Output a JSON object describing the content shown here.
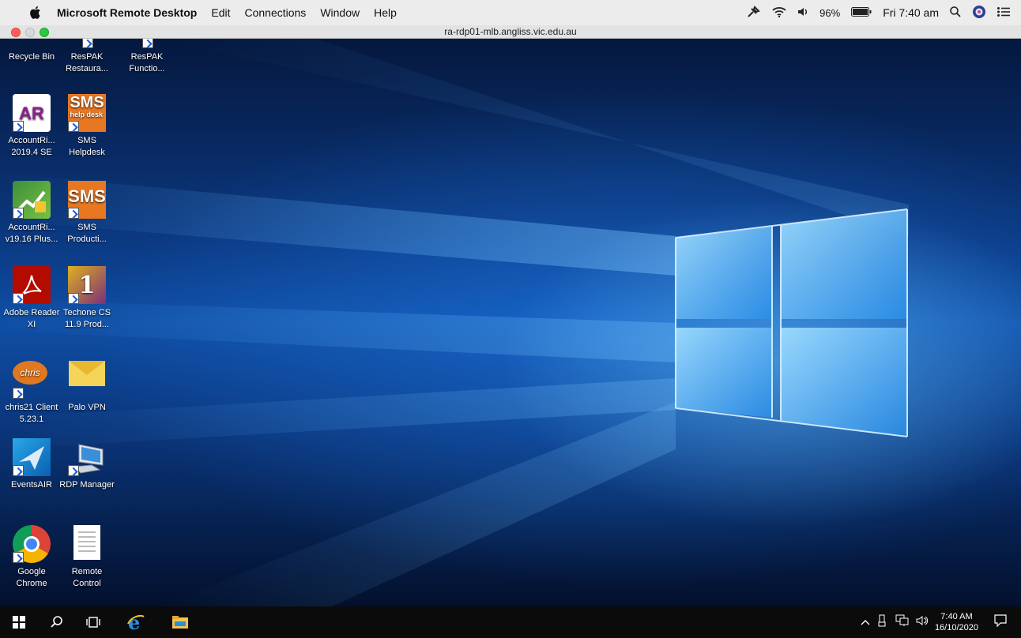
{
  "menubar": {
    "app_name": "Microsoft Remote Desktop",
    "menus": [
      "Edit",
      "Connections",
      "Window",
      "Help"
    ],
    "battery": "96%",
    "time": "Fri 7:40 am"
  },
  "window": {
    "title": "ra-rdp01-mlb.angliss.vic.edu.au"
  },
  "desktop": {
    "icons": [
      {
        "label": "Recycle Bin",
        "icon": "recycle-bin-icon"
      },
      {
        "label": "ResPAK Restaura...",
        "icon": "respak-icon"
      },
      {
        "label": "ResPAK Functio...",
        "icon": "respak-icon"
      },
      {
        "label": "AccountRi... 2019.4 SE",
        "icon": "accountright-icon",
        "text": "AR"
      },
      {
        "label": "SMS Helpdesk",
        "icon": "sms-helpdesk-icon",
        "text": "SMS",
        "sub": "help desk"
      },
      {
        "label": "AccountRi... v19.16 Plus...",
        "icon": "accountright-plus-icon"
      },
      {
        "label": "SMS Producti...",
        "icon": "sms-production-icon",
        "text": "SMS"
      },
      {
        "label": "Adobe Reader XI",
        "icon": "adobe-reader-icon"
      },
      {
        "label": "Techone CS 11.9 Prod...",
        "icon": "techone-icon",
        "text": "1"
      },
      {
        "label": "chris21 Client 5.23.1",
        "icon": "chris21-icon",
        "text": "chris"
      },
      {
        "label": "Palo VPN",
        "icon": "palo-vpn-icon"
      },
      {
        "label": "EventsAIR",
        "icon": "eventsair-icon"
      },
      {
        "label": "RDP Manager",
        "icon": "rdp-manager-icon"
      },
      {
        "label": "Google Chrome",
        "icon": "chrome-icon"
      },
      {
        "label": "Remote Control",
        "icon": "document-icon"
      }
    ]
  },
  "taskbar": {
    "time": "7:40 AM",
    "date": "16/10/2020"
  }
}
